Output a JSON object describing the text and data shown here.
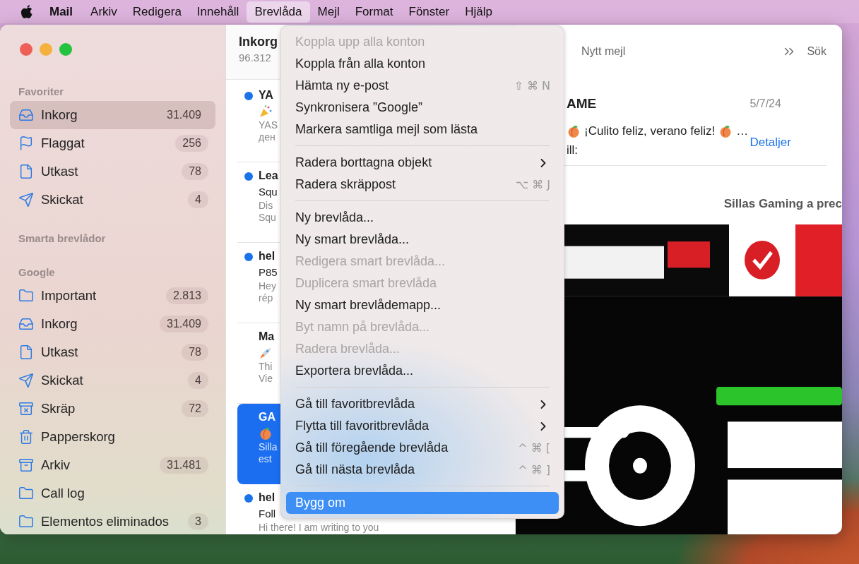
{
  "menu_bar": {
    "app": "Mail",
    "menus": [
      {
        "label": "Arkiv",
        "selected": false
      },
      {
        "label": "Redigera",
        "selected": false
      },
      {
        "label": "Innehåll",
        "selected": false
      },
      {
        "label": "Brevlåda",
        "selected": true
      },
      {
        "label": "Mejl",
        "selected": false
      },
      {
        "label": "Format",
        "selected": false
      },
      {
        "label": "Fönster",
        "selected": false
      },
      {
        "label": "Hjälp",
        "selected": false
      }
    ]
  },
  "sidebar": {
    "sections": [
      {
        "title": "Favoriter",
        "items": [
          {
            "label": "Inkorg",
            "kind": "inbox",
            "count": "31.409",
            "selected": true
          },
          {
            "label": "Flaggat",
            "kind": "flag",
            "count": "256",
            "selected": false
          },
          {
            "label": "Utkast",
            "kind": "draft",
            "count": "78",
            "selected": false
          },
          {
            "label": "Skickat",
            "kind": "sent",
            "count": "4",
            "selected": false
          }
        ]
      },
      {
        "title": "Smarta brevlådor"
      },
      {
        "title": "Google",
        "items": [
          {
            "label": "Important",
            "kind": "folder",
            "count": "2.813",
            "selected": false
          },
          {
            "label": "Inkorg",
            "kind": "inbox",
            "count": "31.409",
            "selected": false
          },
          {
            "label": "Utkast",
            "kind": "draft",
            "count": "78",
            "selected": false
          },
          {
            "label": "Skickat",
            "kind": "sent",
            "count": "4",
            "selected": false
          },
          {
            "label": "Skräp",
            "kind": "junk",
            "count": "72",
            "selected": false
          },
          {
            "label": "Papperskorg",
            "kind": "trash",
            "selected": false
          },
          {
            "label": "Arkiv",
            "kind": "archive",
            "count": "31.481",
            "selected": false
          },
          {
            "label": "Call log",
            "kind": "folder",
            "selected": false
          },
          {
            "label": "Elementos eliminados",
            "kind": "folder",
            "count": "3",
            "selected": false
          }
        ]
      }
    ]
  },
  "message_list": {
    "title": "Inkorg",
    "subtitle": "96.312",
    "messages": [
      {
        "sender": "YA",
        "unread": true,
        "selected": false,
        "kind": "party",
        "preview": [
          "YAS",
          "ден"
        ]
      },
      {
        "sender": "Lea",
        "unread": true,
        "selected": false,
        "subject": "Squ",
        "preview": [
          "Dis",
          "Squ"
        ]
      },
      {
        "sender": "hel",
        "unread": true,
        "selected": false,
        "subject": "P85",
        "preview": [
          "Hey",
          "rép"
        ]
      },
      {
        "sender": "Ma",
        "unread": false,
        "selected": false,
        "kind": "rocket",
        "preview": [
          "Thi",
          "Vie"
        ]
      },
      {
        "sender": "GA",
        "unread": false,
        "selected": true,
        "kind": "peach",
        "preview": [
          "Silla",
          "est"
        ]
      },
      {
        "sender": "hel",
        "unread": true,
        "selected": false,
        "subject": "Foll",
        "preview": [
          "Hi there! I am writing to you"
        ]
      }
    ]
  },
  "reader": {
    "toolbar": {
      "new_message": "Nytt mejl",
      "search": "Sök"
    },
    "header": {
      "sender": "AME",
      "date": "5/7/24",
      "subject": "¡Culito feliz, verano feliz!",
      "subject_end": "…",
      "to_label": "ill:",
      "details_link": "Detaljer"
    },
    "body": {
      "headline": "Sillas Gaming a prec"
    }
  },
  "dropdown": {
    "items": [
      {
        "kind": "item",
        "label": "Koppla upp alla konton",
        "disabled": true,
        "submenu": false,
        "selected": false
      },
      {
        "kind": "item",
        "label": "Koppla från alla konton",
        "disabled": false,
        "submenu": false,
        "selected": false
      },
      {
        "kind": "item",
        "label": "Hämta ny e-post",
        "shortcut": "⇧ ⌘ N",
        "disabled": false,
        "submenu": false,
        "selected": false
      },
      {
        "kind": "item",
        "label": "Synkronisera ”Google”",
        "disabled": false,
        "submenu": false,
        "selected": false
      },
      {
        "kind": "item",
        "label": "Markera samtliga mejl som lästa",
        "disabled": false,
        "submenu": false,
        "selected": false
      },
      {
        "kind": "separator"
      },
      {
        "kind": "item",
        "label": "Radera borttagna objekt",
        "disabled": false,
        "submenu": true,
        "selected": false
      },
      {
        "kind": "item",
        "label": "Radera skräppost",
        "shortcut": "⌥ ⌘ J",
        "disabled": false,
        "submenu": false,
        "selected": false
      },
      {
        "kind": "separator"
      },
      {
        "kind": "item",
        "label": "Ny brevlåda...",
        "disabled": false,
        "submenu": false,
        "selected": false
      },
      {
        "kind": "item",
        "label": "Ny smart brevlåda...",
        "disabled": false,
        "submenu": false,
        "selected": false
      },
      {
        "kind": "item",
        "label": "Redigera smart brevlåda...",
        "disabled": true,
        "submenu": false,
        "selected": false
      },
      {
        "kind": "item",
        "label": "Duplicera smart brevlåda",
        "disabled": true,
        "submenu": false,
        "selected": false
      },
      {
        "kind": "item",
        "label": "Ny smart brevlådemapp...",
        "disabled": false,
        "submenu": false,
        "selected": false
      },
      {
        "kind": "item",
        "label": "Byt namn på brevlåda...",
        "disabled": true,
        "submenu": false,
        "selected": false
      },
      {
        "kind": "item",
        "label": "Radera brevlåda...",
        "disabled": true,
        "submenu": false,
        "selected": false
      },
      {
        "kind": "item",
        "label": "Exportera brevlåda...",
        "disabled": false,
        "submenu": false,
        "selected": false
      },
      {
        "kind": "separator"
      },
      {
        "kind": "item",
        "label": "Gå till favoritbrevlåda",
        "disabled": false,
        "submenu": true,
        "selected": false
      },
      {
        "kind": "item",
        "label": "Flytta till favoritbrevlåda",
        "disabled": false,
        "submenu": true,
        "selected": false
      },
      {
        "kind": "item",
        "label": "Gå till föregående brevlåda",
        "shortcut": "^ ⌘ [",
        "disabled": false,
        "submenu": false,
        "selected": false
      },
      {
        "kind": "item",
        "label": "Gå till nästa brevlåda",
        "shortcut": "^ ⌘ ]",
        "disabled": false,
        "submenu": false,
        "selected": false
      },
      {
        "kind": "separator"
      },
      {
        "kind": "item",
        "label": "Bygg om",
        "disabled": false,
        "submenu": false,
        "selected": true
      }
    ]
  }
}
